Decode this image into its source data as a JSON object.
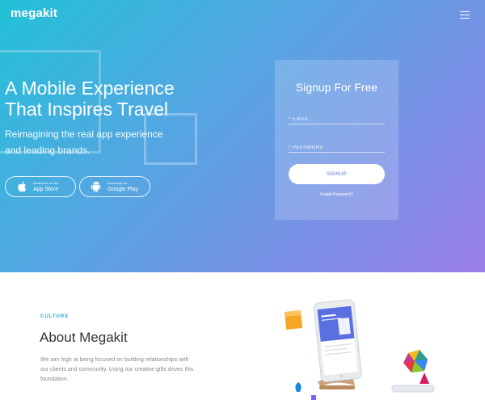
{
  "header": {
    "logo": "megakit",
    "menu_icon": "hamburger-icon"
  },
  "hero": {
    "headline_lines": [
      "A Mobile Experience",
      "That Inspires Travel"
    ],
    "subhead_lines": [
      "Reimagining the real app experience",
      "and leading brands."
    ],
    "app_store": {
      "small": "Download on the",
      "big": "App Store",
      "icon": "apple-icon"
    },
    "google_play": {
      "small": "Download on",
      "big": "Google Play",
      "icon": "android-icon"
    }
  },
  "signup": {
    "title": "Signup For Free",
    "email_placeholder": "* EMAIL",
    "password_placeholder": "* PASSWORD",
    "button": "SIGNUP",
    "forgot": "Forgot Password?"
  },
  "about": {
    "eyebrow": "CULTURE",
    "title": "About Megakit",
    "text_lines": [
      "We aim high at being focused on building relationships with",
      "our clients and community. Using our creative gifts drives this",
      "foundation."
    ]
  },
  "colors": {
    "accent": "#22a8d8",
    "gradient_start": "#22c1d8",
    "gradient_end": "#9b7fe8"
  }
}
